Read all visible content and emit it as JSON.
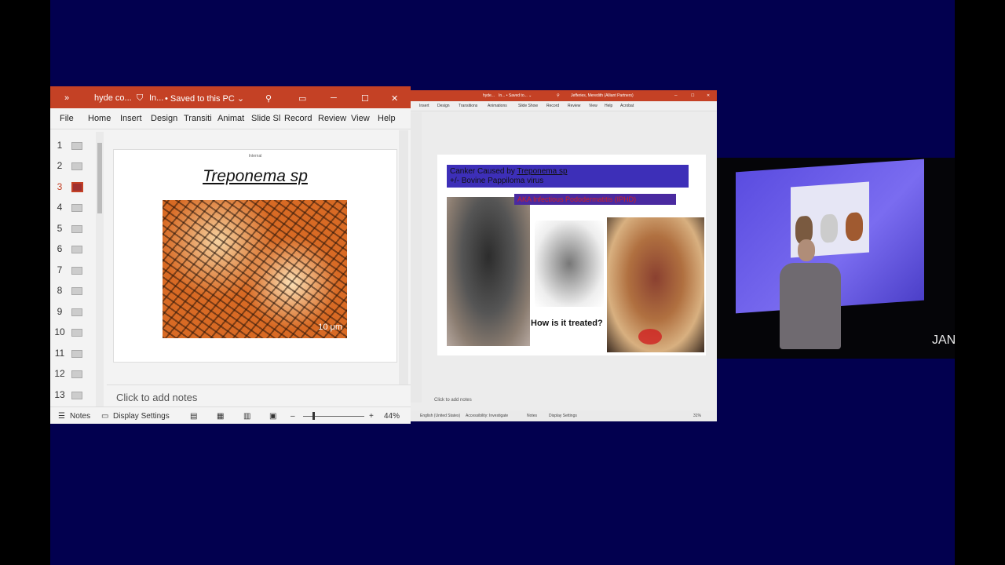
{
  "left_window": {
    "title": {
      "chevron": "»",
      "file": "hyde co...",
      "label": "In...",
      "saved": "• Saved to this PC ⌄"
    },
    "ribbon_tabs": [
      "File",
      "Home",
      "Insert",
      "Design",
      "Transiti",
      "Animat",
      "Slide Sl",
      "Record",
      "Review",
      "View",
      "Help"
    ],
    "thumbnails": [
      "1",
      "2",
      "3",
      "4",
      "5",
      "6",
      "7",
      "8",
      "9",
      "10",
      "11",
      "12",
      "13"
    ],
    "active_thumbnail": "3",
    "slide": {
      "tiny_label": "Internal",
      "title": "Treponema sp",
      "scale_label": "10 μm"
    },
    "notes_placeholder": "Click to add notes",
    "status": {
      "notes": "Notes",
      "display_settings": "Display Settings",
      "zoom_minus": "–",
      "zoom_plus": "+",
      "zoom": "44%"
    }
  },
  "right_window": {
    "title": {
      "file": "hyde...",
      "label": "In... • Saved to... ⌄",
      "user": "Jefferies, Meredith (Alliant Partners)"
    },
    "ribbon_tabs": [
      "Insert",
      "Design",
      "Transitions",
      "Animations",
      "Slide Show",
      "Record",
      "Review",
      "View",
      "Help",
      "Acrobat"
    ],
    "slide": {
      "title_line1_prefix": "Canker Caused by ",
      "title_line1_link": "Treponema sp",
      "title_line2": "+/- Bovine Pappiloma virus",
      "red_text": "AKA Infectious Pododermatitis (IPHD)",
      "caption": "How is it treated?"
    },
    "notes_placeholder": "Click to add notes",
    "status": {
      "language": "English (United States)",
      "accessibility": "Accessibility: Investigate",
      "notes": "Notes",
      "display_settings": "Display Settings",
      "zoom": "31%"
    }
  },
  "camera": {
    "overlay_text": "JAN"
  }
}
